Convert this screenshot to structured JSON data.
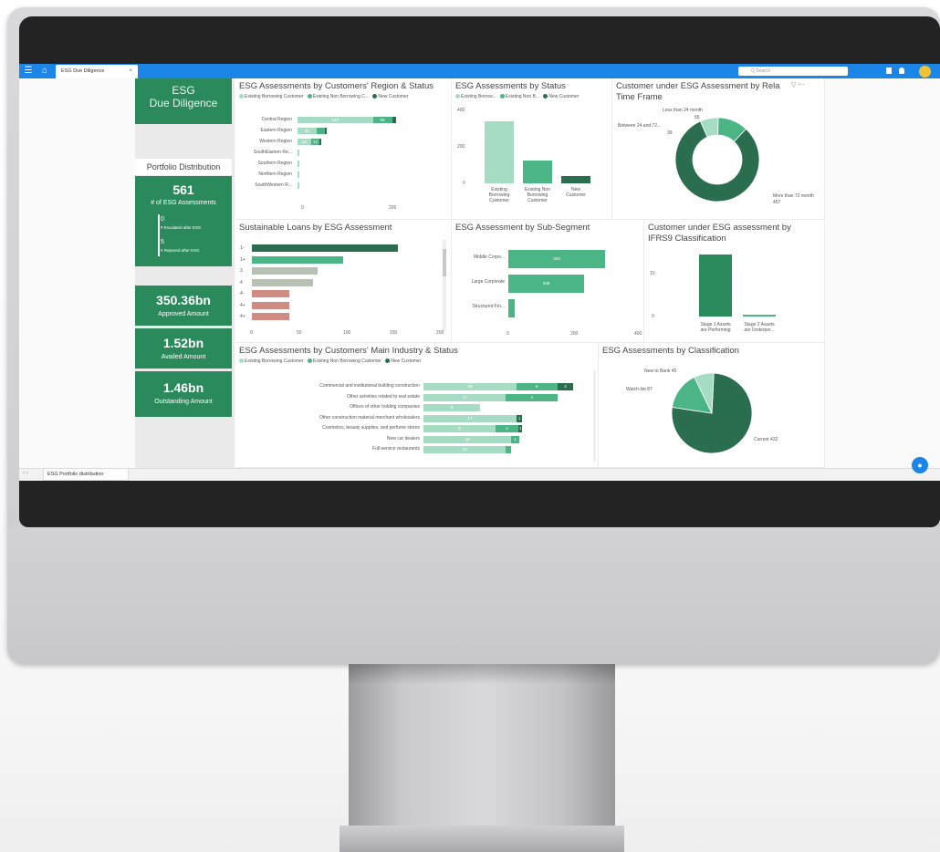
{
  "app": {
    "tab_label": "ESG Due Diligence",
    "search_placeholder": "Q Search",
    "bottom_tab": "ESG Portfolio distribution"
  },
  "sidebar": {
    "title_line1": "ESG",
    "title_line2": "Due Diligence",
    "portfolio_label": "Portfolio Distribution",
    "assessments_count": "561",
    "assessments_label": "# of ESG Assessments",
    "escalated_value": "0",
    "escalated_label": "# Escalated after ESG",
    "rejected_value": "5",
    "rejected_label": "# Rejected after ESG",
    "approved_value": "350.36bn",
    "approved_label": "Approved Amount",
    "availed_value": "1.52bn",
    "availed_label": "Availed Amount",
    "outstanding_value": "1.46bn",
    "outstanding_label": "Outstanding Amount"
  },
  "colors": {
    "dark": "#2b6e4f",
    "mid": "#4bb585",
    "light": "#a7dcc4",
    "rose": "#cf8c80",
    "brand": "#2a8a5b",
    "topbar": "#1c86e8"
  },
  "region": {
    "title": "ESG Assessments by Customers' Region & Status",
    "legend": [
      "Existing Borrowing Customer",
      "Existing Non Borrowing C...",
      "New Customer"
    ],
    "rows": [
      {
        "label": "Central Region",
        "a": 110,
        "b": 28,
        "c": 6,
        "la": "140",
        "lb": "93"
      },
      {
        "label": "Eastern Region",
        "a": 28,
        "b": 12,
        "c": 2,
        "la": "30",
        "lb": ""
      },
      {
        "label": "Western Region",
        "a": 20,
        "b": 12,
        "c": 1,
        "la": "22",
        "lb": "12"
      },
      {
        "label": "SouthEastern Re...",
        "a": 3,
        "b": 0,
        "c": 0,
        "la": "",
        "lb": ""
      },
      {
        "label": "Southern Region",
        "a": 3,
        "b": 0,
        "c": 0,
        "la": "",
        "lb": ""
      },
      {
        "label": "Northern Region",
        "a": 3,
        "b": 0,
        "c": 0,
        "la": "",
        "lb": ""
      },
      {
        "label": "SouthWestern R...",
        "a": 1,
        "b": 0,
        "c": 0,
        "la": "",
        "lb": ""
      }
    ],
    "ticks": [
      "0",
      "200"
    ]
  },
  "status": {
    "title": "ESG Assessments by Status",
    "legend": [
      "Existing Borrow...",
      "Existing Non B...",
      "New Customer"
    ],
    "bars": [
      {
        "label_l1": "Existing",
        "label_l2": "Borrowing",
        "label_l3": "Customer",
        "value": 330
      },
      {
        "label_l1": "Existing Non",
        "label_l2": "Borrowing",
        "label_l3": "Customer",
        "value": 120
      },
      {
        "label_l1": "New",
        "label_l2": "Customer",
        "label_l3": "",
        "value": 40
      }
    ],
    "ticks": [
      "400",
      "200",
      "0"
    ]
  },
  "timeframe": {
    "title_l1": "Customer under ESG Assessment by Rela",
    "title_l2": "Time Frame",
    "slices": [
      {
        "label": "More than 72 month",
        "value": 457
      },
      {
        "label": "Between 24 and 72 ...",
        "value": 39
      },
      {
        "label": "Less than 24 month",
        "value": 65
      }
    ],
    "lbl_lt24": "Less than 24 month",
    "val_lt24": "65",
    "lbl_24_72": "Between 24 and 72...",
    "val_24_72": "39",
    "lbl_gt72": "More than 72 month",
    "val_gt72": "457"
  },
  "loans": {
    "title": "Sustainable Loans by ESG Assessment",
    "rows": [
      {
        "label": "1-",
        "value": 155,
        "color": "dark"
      },
      {
        "label": "1+",
        "value": 97,
        "color": "mid"
      },
      {
        "label": "3",
        "value": 70,
        "color": "gray"
      },
      {
        "label": "4",
        "value": 65,
        "color": "gray"
      },
      {
        "label": "4-",
        "value": 40,
        "color": "rose"
      },
      {
        "label": "4+",
        "value": 40,
        "color": "rose"
      },
      {
        "label": "4+",
        "value": 40,
        "color": "rose"
      }
    ],
    "ticks": [
      "0",
      "50",
      "100",
      "150",
      "200"
    ]
  },
  "subsegment": {
    "title": "ESG Assessment by Sub-Segment",
    "rows": [
      {
        "label": "Middle Corpo...",
        "value": 303,
        "text": "303"
      },
      {
        "label": "Large Corporate",
        "value": 238,
        "text": "238"
      },
      {
        "label": "Structured Fin...",
        "value": 20,
        "text": ""
      }
    ],
    "ticks": [
      "0",
      "200",
      "400"
    ]
  },
  "ifrs": {
    "title_l1": "Customer under ESG assessment by",
    "title_l2": "IFRS9 Classification",
    "bars": [
      {
        "label_l1": "Stage 1 Assets",
        "label_l2": "are Performing",
        "value": 14
      },
      {
        "label_l1": "Stage 2 Assets",
        "label_l2": "are Underper...",
        "value": 0.5
      }
    ],
    "ticks": [
      "10",
      "0"
    ]
  },
  "industry": {
    "title": "ESG Assessments by Customers' Main Industry & Status",
    "legend": [
      "Existing Borrowing Customer",
      "Existing Non Borrowing Customer",
      "New Customer"
    ],
    "rows": [
      {
        "label": "Commercial and institutional building construction",
        "a": 90,
        "b": 40,
        "c": 15,
        "ta": "29",
        "tb": "8",
        "tc": "3"
      },
      {
        "label": "Other activities related to real estate",
        "a": 80,
        "b": 50,
        "c": 0,
        "ta": "17",
        "tb": "4",
        "tc": ""
      },
      {
        "label": "Offices of other holding companies",
        "a": 55,
        "b": 0,
        "c": 0,
        "ta": "8",
        "tb": "",
        "tc": ""
      },
      {
        "label": "Other construction material merchant wholesalers",
        "a": 90,
        "b": 0,
        "c": 6,
        "ta": "17",
        "tb": "",
        "tc": "1"
      },
      {
        "label": "Cosmetics, beauty supplies, and perfume stores",
        "a": 70,
        "b": 22,
        "c": 4,
        "ta": "5",
        "tb": "4",
        "tc": "1"
      },
      {
        "label": "New car dealers",
        "a": 85,
        "b": 8,
        "c": 0,
        "ta": "16",
        "tb": "1",
        "tc": ""
      },
      {
        "label": "Full-service restaurants",
        "a": 80,
        "b": 5,
        "c": 0,
        "ta": "16",
        "tb": "",
        "tc": ""
      }
    ]
  },
  "classification": {
    "title": "ESG Assessments by Classification",
    "slices": [
      {
        "label": "Current 432",
        "value": 432
      },
      {
        "label": "Watch-list 87",
        "value": 87
      },
      {
        "label": "New to Bank 45",
        "value": 45
      }
    ],
    "lbl_new": "New to Bank 45",
    "lbl_watch": "Watch-list 87",
    "lbl_current": "Current 432"
  }
}
